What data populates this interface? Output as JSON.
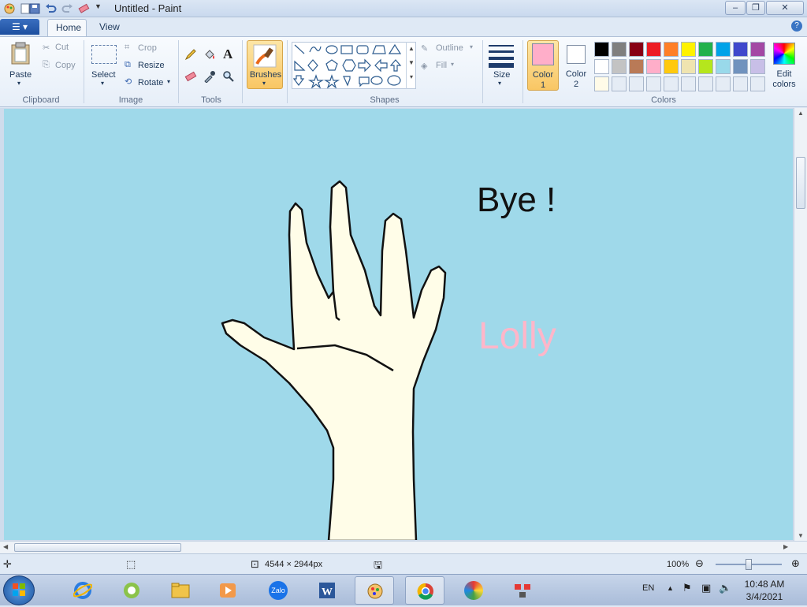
{
  "window": {
    "title": "Untitled - Paint"
  },
  "tabs": [
    {
      "label": "Home"
    },
    {
      "label": "View"
    }
  ],
  "ribbon": {
    "clipboard": {
      "paste": "Paste",
      "cut": "Cut",
      "copy": "Copy",
      "group": "Clipboard"
    },
    "image": {
      "select": "Select",
      "crop": "Crop",
      "resize": "Resize",
      "rotate": "Rotate",
      "group": "Image"
    },
    "tools": {
      "group": "Tools"
    },
    "brushes": {
      "label": "Brushes"
    },
    "shapes": {
      "outline": "Outline",
      "fill": "Fill",
      "group": "Shapes"
    },
    "size": {
      "label": "Size"
    },
    "colors": {
      "color1_label": "Color",
      "color1_num": "1",
      "color2_label": "Color",
      "color2_num": "2",
      "edit_colors_line1": "Edit",
      "edit_colors_line2": "colors",
      "group": "Colors",
      "color1": "#ffaec9",
      "color2": "#ffffff",
      "palette_row1": [
        "#000000",
        "#7f7f7f",
        "#880015",
        "#ed1c24",
        "#ff7f27",
        "#fff200",
        "#22b14c",
        "#00a2e8",
        "#3f48cc",
        "#a349a4"
      ],
      "palette_row2": [
        "#ffffff",
        "#c3c3c3",
        "#b97a57",
        "#ffaec9",
        "#ffc90e",
        "#efe4b0",
        "#b5e61d",
        "#99d9ea",
        "#7092be",
        "#c8bfe7"
      ],
      "palette_row3": [
        "#fffbe8",
        "#e5ecf5",
        "#e5ecf5",
        "#e5ecf5",
        "#e5ecf5",
        "#e5ecf5",
        "#e5ecf5",
        "#e5ecf5",
        "#e5ecf5",
        "#e5ecf5"
      ]
    }
  },
  "canvas": {
    "background": "#9fd9ea",
    "text_black": "Bye !",
    "text_pink": "Lolly"
  },
  "status": {
    "dimensions": "4544 × 2944px",
    "zoom": "100%"
  },
  "taskbar": {
    "language": "EN",
    "time": "10:48 AM",
    "date": "3/4/2021",
    "zalo_label": "Zalo"
  }
}
